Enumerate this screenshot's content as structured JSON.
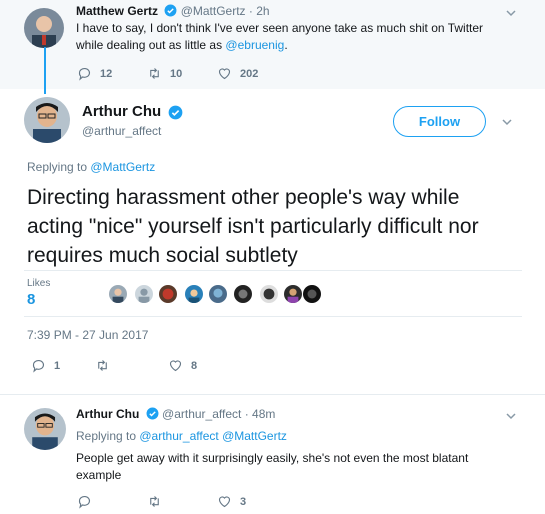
{
  "parent_tweet": {
    "name": "Matthew Gertz",
    "handle": "@MattGertz",
    "time": "· 2h",
    "text_main": "I have to say, I don't think I've ever seen anyone take as much shit on Twitter while dealing out as little as ",
    "text_mention": "@ebruenig",
    "text_end": ".",
    "replies": "12",
    "retweets": "10",
    "likes": "202"
  },
  "main_tweet": {
    "name": "Arthur Chu",
    "handle": "@arthur_affect",
    "follow_label": "Follow",
    "replying_prefix": "Replying to ",
    "replying_handle": "@MattGertz",
    "text": "Directing harassment other people's way while acting \"nice\" yourself isn't particularly difficult nor requires much social subtlety",
    "likes_label": "Likes",
    "likes_count": "8",
    "timestamp": "7:39 PM - 27 Jun 2017",
    "replies": "1",
    "retweets": "",
    "likes": "8"
  },
  "reply_tweet": {
    "name": "Arthur Chu",
    "handle": "@arthur_affect",
    "time": "· 48m",
    "replying_prefix": "Replying to ",
    "replying_handle1": "@arthur_affect",
    "replying_handle2": "@MattGertz",
    "text": "People get away with it surprisingly easily, she's not even the most blatant example",
    "replies": "",
    "retweets": "",
    "likes": "3"
  },
  "colors": {
    "accent": "#1da1f2",
    "link": "#1b95e0",
    "grey": "#657786",
    "parent_bg": "#f5f8fa"
  }
}
